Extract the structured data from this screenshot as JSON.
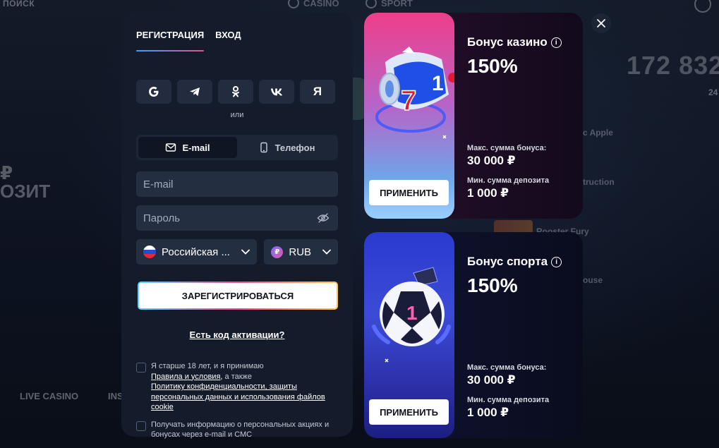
{
  "background": {
    "search_label": "ПОИСК",
    "casino_label": "CASINO",
    "sport_label": "SPORT",
    "big_number": "172 832",
    "small_number": "24",
    "game_1": "c Apple",
    "game_2": "truction",
    "game_3": "Rooster Fury",
    "game_4": "ouse",
    "promo_line_1": "₽",
    "promo_line_2": "ОЗИТ",
    "nav_live": "LIVE CASINO",
    "nav_ins": "INS"
  },
  "registration": {
    "tabs": [
      {
        "label": "РЕГИСТРАЦИЯ",
        "active": true
      },
      {
        "label": "ВХОД",
        "active": false
      }
    ],
    "social": [
      "google-icon",
      "telegram-icon",
      "odnoklassniki-icon",
      "vk-icon",
      "yandex-icon"
    ],
    "yandex_glyph": "Я",
    "or_label": "или",
    "methods": [
      {
        "label": "E-mail",
        "icon": "mail-icon",
        "active": true
      },
      {
        "label": "Телефон",
        "icon": "phone-icon",
        "active": false
      }
    ],
    "email_placeholder": "E-mail",
    "password_placeholder": "Пароль",
    "country_value": "Российская ...",
    "currency_symbol": "₽",
    "currency_value": "RUB",
    "register_label": "ЗАРЕГИСТРИРОВАТЬСЯ",
    "activation_link": "Есть код активации?",
    "consent": {
      "prefix": "Я старше 18 лет, и я принимаю",
      "rules_link": "Правила и условия,",
      "middle": " а также",
      "policy_link": "Политику конфиденциальности, защиты персональных данных и использования файлов cookie"
    },
    "newsletter_text": "Получать информацию о персональных акциях и бонусах через e-mail и СМС"
  },
  "bonuses": [
    {
      "title": "Бонус казино",
      "percent": "150%",
      "max_label": "Макс. сумма бонуса:",
      "max_value": "30 000 ₽",
      "min_label": "Мин. сумма депозита",
      "min_value": "1 000 ₽",
      "apply_label": "ПРИМЕНИТЬ"
    },
    {
      "title": "Бонус спорта",
      "percent": "150%",
      "max_label": "Макс. сумма бонуса:",
      "max_value": "30 000 ₽",
      "min_label": "Мин. сумма депозита",
      "min_value": "1 000 ₽",
      "apply_label": "ПРИМЕНИТЬ"
    }
  ],
  "info_glyph": "i",
  "colors": {
    "panel_bg": "#141b2a",
    "field_bg": "#242e41",
    "accent_gradient_start": "#3aa0ff",
    "accent_gradient_end": "#e8508a"
  }
}
